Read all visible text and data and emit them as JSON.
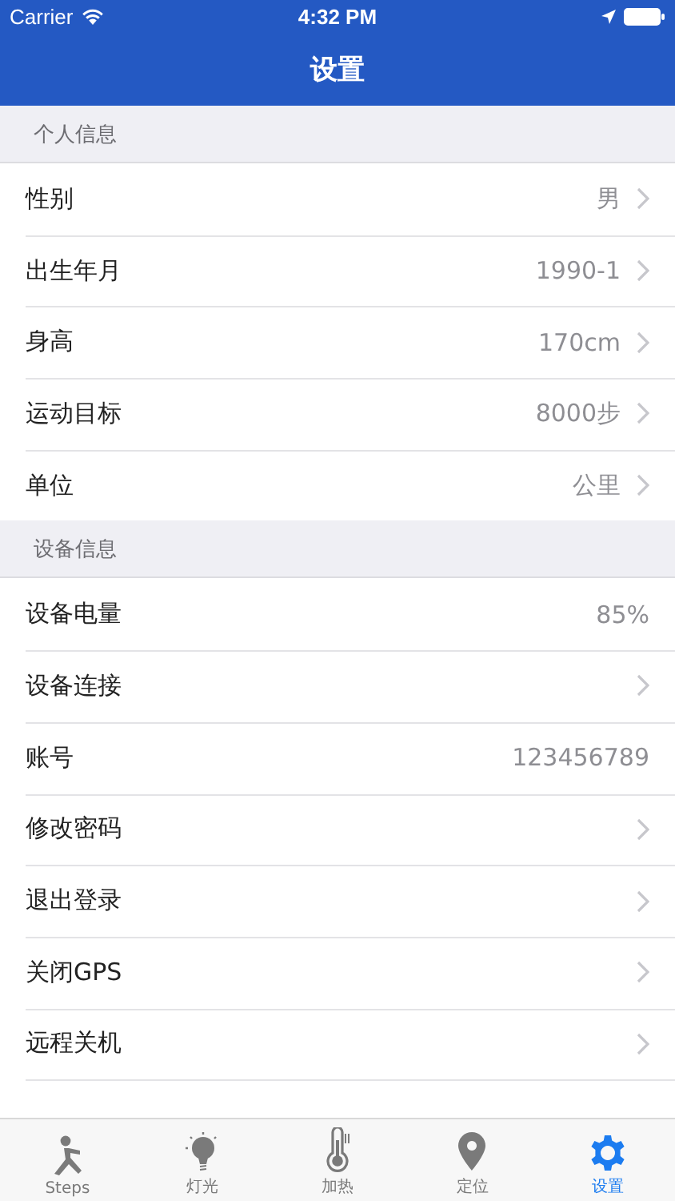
{
  "status_bar": {
    "carrier": "Carrier",
    "time": "4:32 PM"
  },
  "nav_bar": {
    "title": "设置"
  },
  "sections": [
    {
      "title": "个人信息",
      "rows": [
        {
          "label": "性别",
          "value": "男",
          "chevron": true
        },
        {
          "label": "出生年月",
          "value": "1990-1",
          "chevron": true
        },
        {
          "label": "身高",
          "value": "170cm",
          "chevron": true
        },
        {
          "label": "运动目标",
          "value": "8000步",
          "chevron": true
        },
        {
          "label": "单位",
          "value": "公里",
          "chevron": true
        }
      ]
    },
    {
      "title": "设备信息",
      "rows": [
        {
          "label": "设备电量",
          "value": "85%",
          "chevron": false
        },
        {
          "label": "设备连接",
          "chevron": true
        },
        {
          "label": "账号",
          "value": "123456789",
          "chevron": false
        },
        {
          "label": "修改密码",
          "chevron": true
        },
        {
          "label": "退出登录",
          "chevron": true
        },
        {
          "label": "关闭GPS",
          "chevron": true
        },
        {
          "label": "远程关机",
          "chevron": true
        }
      ]
    }
  ],
  "tab_bar": [
    {
      "label": "Steps",
      "kind": "steps",
      "selected": false
    },
    {
      "label": "灯光",
      "kind": "light",
      "selected": false
    },
    {
      "label": "加热",
      "kind": "heat",
      "selected": false
    },
    {
      "label": "定位",
      "kind": "location",
      "selected": false
    },
    {
      "label": "设置",
      "kind": "settings",
      "selected": true
    }
  ]
}
